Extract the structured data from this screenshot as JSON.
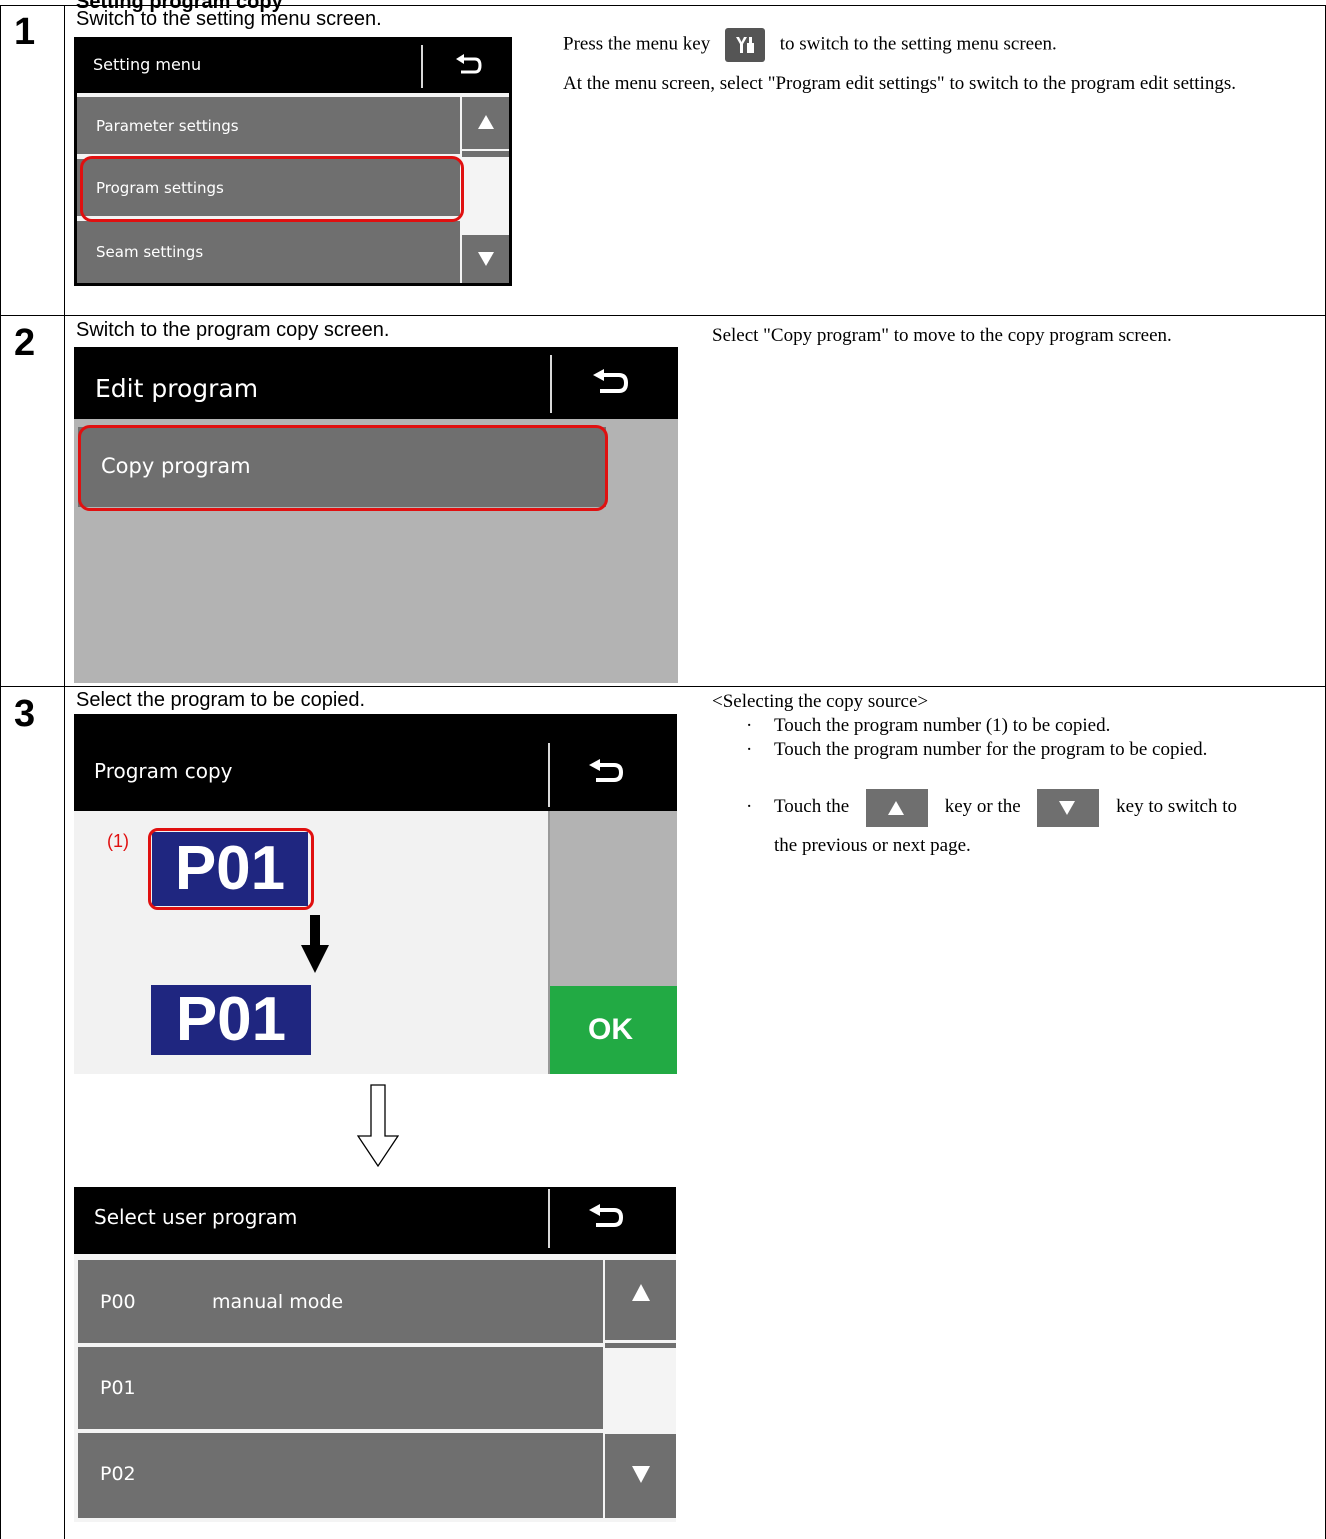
{
  "page_title": "Setting program copy",
  "steps": [
    {
      "number": "1",
      "caption": "Switch to the setting menu screen.",
      "desc_before_key": "Press the menu key",
      "desc_after_key": "to switch to the setting menu screen.",
      "desc_p2": "At the menu screen, select \"Program edit settings\" to switch to the program edit settings.",
      "screen": {
        "title": "Setting menu",
        "items": [
          "Parameter settings",
          "Program settings",
          "Seam settings"
        ]
      }
    },
    {
      "number": "2",
      "caption": "Switch to the program copy screen.",
      "desc": "Select \"Copy program\" to move to the copy program screen.",
      "screen": {
        "title": "Edit program",
        "items": [
          "Copy program"
        ]
      }
    },
    {
      "number": "3",
      "caption": "Select the program to be copied.",
      "desc_heading": "<Selecting the copy source>",
      "bullets": [
        "Touch the program number (1) to be copied.",
        "Touch the program number for the program to be copied."
      ],
      "bullet3_a": "Touch the",
      "bullet3_b": "key or the",
      "bullet3_c": "key to switch to",
      "bullet3_d": "the previous or next page.",
      "bullet_dot": "·",
      "copy_screen": {
        "title": "Program copy",
        "marker": "(1)",
        "source": "P01",
        "dest": "P01",
        "ok": "OK"
      },
      "select_screen": {
        "title": "Select user program",
        "items": [
          {
            "code": "P00",
            "name": "manual mode"
          },
          {
            "code": "P01",
            "name": ""
          },
          {
            "code": "P02",
            "name": ""
          }
        ]
      }
    }
  ],
  "colors": {
    "header": "#000000",
    "row": "#6f6f6f",
    "highlight": "#e01010",
    "program_box": "#1f2680",
    "ok": "#22aa44"
  }
}
